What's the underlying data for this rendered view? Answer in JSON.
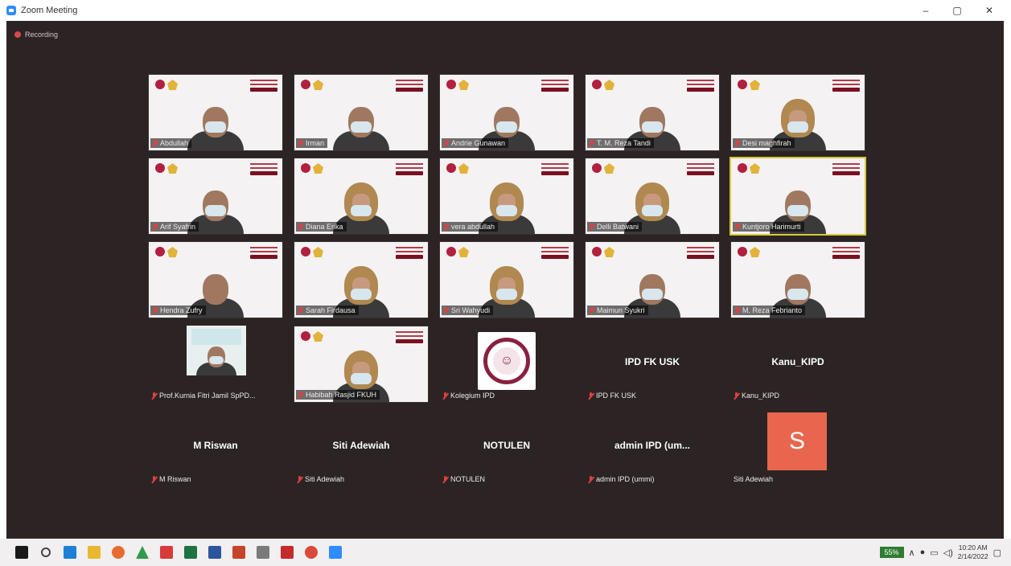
{
  "window": {
    "title": "Zoom Meeting",
    "controls": [
      "–",
      "▢",
      "✕"
    ]
  },
  "recording": {
    "label": "Recording"
  },
  "participants": [
    {
      "name": "Abdullah",
      "type": "video",
      "look": "mask"
    },
    {
      "name": "Irman",
      "type": "video",
      "look": "mask"
    },
    {
      "name": "Andrie Gunawan",
      "type": "video",
      "look": "mask"
    },
    {
      "name": "T. M. Reza Tandi",
      "type": "video",
      "look": "mask"
    },
    {
      "name": "Desi maghfirah",
      "type": "video",
      "look": "hijab"
    },
    {
      "name": "Arif Syafrin",
      "type": "video",
      "look": "mask"
    },
    {
      "name": "Diana Erika",
      "type": "video",
      "look": "hijab"
    },
    {
      "name": "vera abdullah",
      "type": "video",
      "look": "hijab"
    },
    {
      "name": "Delli Batwani",
      "type": "video",
      "look": "hijab"
    },
    {
      "name": "Kuntjoro Harimurti",
      "type": "video",
      "look": "mask",
      "active": true
    },
    {
      "name": "Hendra Zufry",
      "type": "video",
      "look": "nomask"
    },
    {
      "name": "Sarah Firdausa",
      "type": "video",
      "look": "hijab"
    },
    {
      "name": "Sri Wahyudi",
      "type": "video",
      "look": "hijab"
    },
    {
      "name": "Maimun Syukri",
      "type": "video",
      "look": "mask"
    },
    {
      "name": "M. Reza Febrianto",
      "type": "video",
      "look": "mask"
    },
    {
      "name": "Prof.Kurnia Fitri Jamil SpPD...",
      "type": "small-cam"
    },
    {
      "name": "Habibah Rasjid FKUH",
      "type": "video",
      "look": "hijab"
    },
    {
      "name": "Kolegium IPD",
      "type": "logo"
    },
    {
      "name": "IPD FK USK",
      "type": "plain",
      "display": "IPD FK USK"
    },
    {
      "name": "Kanu_KIPD",
      "type": "plain",
      "display": "Kanu_KIPD"
    },
    {
      "name": "M Riswan",
      "type": "plain",
      "display": "M Riswan"
    },
    {
      "name": "Siti Adewiah",
      "type": "plain",
      "display": "Siti Adewiah"
    },
    {
      "name": "NOTULEN",
      "type": "plain",
      "display": "NOTULEN"
    },
    {
      "name": "admin IPD (ummi)",
      "type": "plain",
      "display": "admin IPD (um..."
    },
    {
      "name": "Siti Adewiah",
      "type": "avatar",
      "initial": "S",
      "muted": false
    }
  ],
  "taskbar": {
    "icons": [
      "windows-start-icon",
      "search-icon",
      "edge-icon",
      "file-explorer-icon",
      "firefox-icon",
      "drive-icon",
      "app-icon",
      "excel-icon",
      "word-icon",
      "powerpoint-icon",
      "paint-icon",
      "acrobat-icon",
      "chrome-icon",
      "zoom-icon"
    ],
    "battery": "55%",
    "time": "10:20 AM",
    "date": "2/14/2022"
  }
}
